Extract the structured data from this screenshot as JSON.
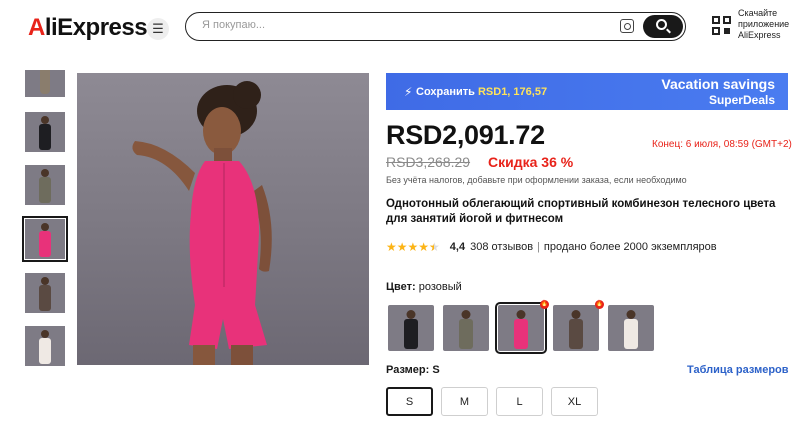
{
  "header": {
    "logo": "AliExpress",
    "search_placeholder": "Я покупаю...",
    "app_promo": [
      "Скачайте",
      "приложение",
      "AliExpress"
    ]
  },
  "promo": {
    "save_label": "Сохранить",
    "save_amount": "RSD1, 176,57",
    "title": "Vacation savings",
    "subtitle": "SuperDeals"
  },
  "product": {
    "price": "RSD2,091.72",
    "ends": "Конец: 6 июля, 08:59 (GMT+2)",
    "old_price": "RSD3,268.29",
    "discount": "Скидка 36 %",
    "tax_note": "Без учёта налогов, добавьте при оформлении заказа, если необходимо",
    "title": "Однотонный облегающий спортивный комбинезон телесного цвета для занятий йогой и фитнесом",
    "rating_value": "4,4",
    "rating_stars": 4.5,
    "reviews": "308 отзывов",
    "sold": "продано более 2000 экземпляров"
  },
  "color": {
    "label": "Цвет:",
    "selected": "розовый",
    "swatches": [
      {
        "name": "black",
        "color": "#1e1e22",
        "hot": false
      },
      {
        "name": "olive",
        "color": "#6e6c5d",
        "hot": false
      },
      {
        "name": "pink",
        "color": "#e8327a",
        "hot": true,
        "selected": true
      },
      {
        "name": "brown",
        "color": "#5a4a42",
        "hot": true
      },
      {
        "name": "white",
        "color": "#efe9e4",
        "hot": false
      }
    ]
  },
  "size": {
    "label": "Размер:",
    "selected": "S",
    "chart_link": "Таблица размеров",
    "options": [
      "S",
      "M",
      "L",
      "XL"
    ]
  },
  "colors": {
    "accent_red": "#e8231a",
    "promo_blue": "#3f6be6",
    "link_blue": "#2d62c9",
    "star": "#fcb416"
  }
}
